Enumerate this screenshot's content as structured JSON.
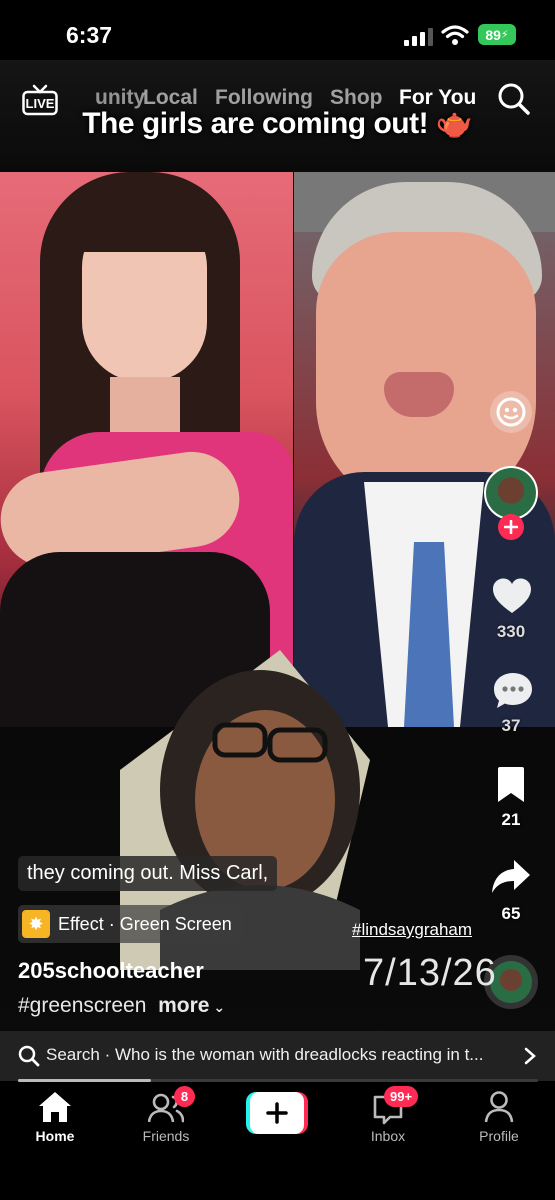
{
  "status_bar": {
    "time": "6:37",
    "battery": "89"
  },
  "top_nav": {
    "live_label": "LIVE",
    "tabs": [
      "unity",
      "Local",
      "Following",
      "Shop",
      "For You"
    ],
    "active_tab": "For You"
  },
  "video": {
    "caption_title": "The girls are coming out! 🫖",
    "subtitle": "they coming out. Miss Carl,",
    "effect_label": "Effect · Green Screen",
    "username": "205schoolteacher",
    "hashtag": "#greenscreen",
    "more_label": "more",
    "overlay_hashtag": "#lindsaygraham",
    "overlay_date": "7/13/26"
  },
  "sidebar": {
    "likes": "330",
    "comments": "37",
    "bookmarks": "21",
    "shares": "65"
  },
  "search": {
    "text": "Search · Who is the woman with dreadlocks reacting in t..."
  },
  "progress": {
    "fraction": 0.255
  },
  "bottom_nav": {
    "items": [
      {
        "label": "Home",
        "icon": "home-icon"
      },
      {
        "label": "Friends",
        "icon": "friends-icon",
        "badge": "8"
      },
      {
        "label": "",
        "icon": "plus-icon"
      },
      {
        "label": "Inbox",
        "icon": "inbox-icon",
        "badge": "99+"
      },
      {
        "label": "Profile",
        "icon": "profile-icon"
      }
    ]
  },
  "colors": {
    "accent": "#fe2c55",
    "battery": "#34c759",
    "create_left": "#25f4ee",
    "create_right": "#fe2c55"
  }
}
